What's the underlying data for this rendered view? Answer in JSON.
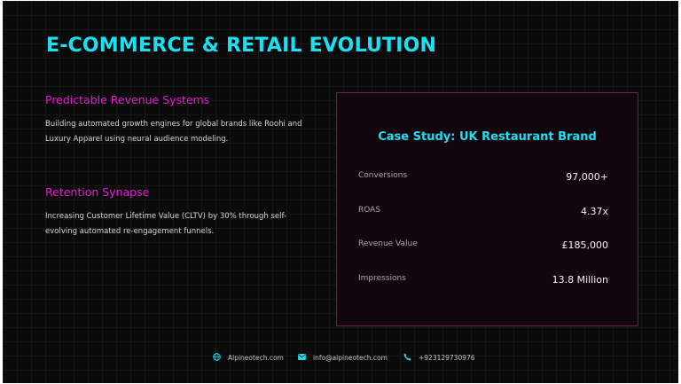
{
  "title": "E-COMMERCE & RETAIL EVOLUTION",
  "sections": [
    {
      "heading": "Predictable Revenue Systems",
      "text": "Building automated growth engines for global brands like Roohi and Luxury Apparel using neural audience modeling."
    },
    {
      "heading": "Retention Synapse",
      "text": "Increasing Customer Lifetime Value (CLTV) by 30% through self-evolving automated re-engagement funnels."
    }
  ],
  "case_study": {
    "title": "Case Study: UK Restaurant Brand",
    "metrics": [
      {
        "label": "Conversions",
        "value": "97,000+"
      },
      {
        "label": "ROAS",
        "value": "4.37x"
      },
      {
        "label": "Revenue Value",
        "value": "£185,000"
      },
      {
        "label": "Impressions",
        "value": "13.8 Million"
      }
    ]
  },
  "footer": {
    "website": "Alpineotech.com",
    "email": "info@alpineotech.com",
    "phone": "+923129730976"
  },
  "colors": {
    "accent_cyan": "#19e0f2",
    "accent_magenta": "#e619d8",
    "background": "#0a0a0a",
    "card_border": "#6a1f5a"
  },
  "icons": {
    "website": "globe-icon",
    "email": "envelope-icon",
    "phone": "phone-icon"
  }
}
